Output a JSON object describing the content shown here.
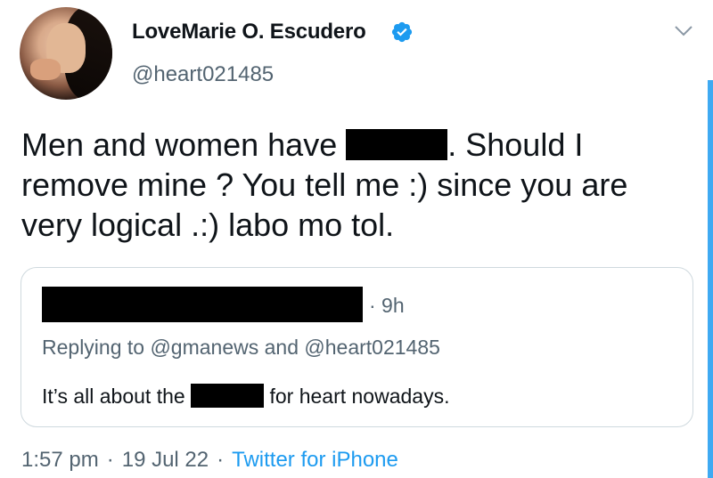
{
  "author": {
    "display_name": "LoveMarie O. Escudero",
    "handle": "@heart021485",
    "verified": true
  },
  "tweet": {
    "text_before": "Men and women have",
    "text_after": ". Should I remove mine ? You tell me :) since you are very logical .:) labo mo tol."
  },
  "quoted_tweet": {
    "time": "· 9h",
    "replying_to": "Replying to @gmanews and @heart021485",
    "text_before": "It’s all about the",
    "text_after": "for heart nowadays."
  },
  "footer": {
    "time": "1:57 pm",
    "separator": "·",
    "date": "19 Jul 22",
    "source": "Twitter for iPhone"
  },
  "colors": {
    "accent": "#1d9bf0",
    "secondary_text": "#536471",
    "border": "#cfd9de"
  },
  "icons": {
    "verified": "verified-badge-icon",
    "more": "chevron-down-icon"
  }
}
